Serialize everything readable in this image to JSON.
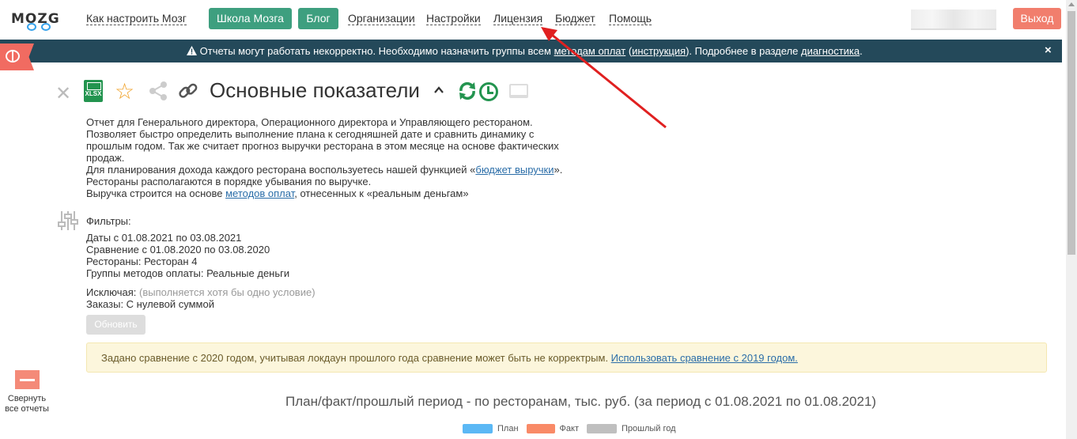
{
  "nav": {
    "logo": "MOZG",
    "links": [
      "Как настроить Мозг",
      "Организации",
      "Настройки",
      "Лицензия",
      "Бюджет",
      "Помощь"
    ],
    "school_button": "Школа Мозга",
    "blog_button": "Блог",
    "logout_button": "Выход"
  },
  "banner": {
    "warning_icon": "warning-icon",
    "text_1": "Отчеты могут работать некорректно. Необходимо назначить группы всем ",
    "link_1": "методам оплат",
    "text_2": " (",
    "link_2": "инструкция",
    "text_3": "). Подробнее в разделе ",
    "link_3": "диагностика",
    "text_4": ".",
    "close": "×"
  },
  "toolbar": {
    "xlsx_label": "XLSX",
    "title": "Основные показатели"
  },
  "description": {
    "line_1": "Отчет для Генерального директора, Операционного директора и Управляющего рестораном.",
    "line_2": "Позволяет быстро определить выполнение плана к сегодняшней дате и сравнить динамику с прошлым годом. Так же считает прогноз выручки ресторана в этом месяце на основе фактических продаж.",
    "line_3_pre": "Для планирования дохода каждого ресторана воспользуетесь нашей функцией «",
    "line_3_link": "бюджет выручки",
    "line_3_post": "».",
    "line_4": "Рестораны располагаются в порядке убывания по выручке.",
    "line_5_pre": "Выручка строится на основе ",
    "line_5_link": "методов оплат",
    "line_5_post": ", отнесенных к «реальным деньгам»"
  },
  "filters": {
    "heading": "Фильтры:",
    "dates_label": "Даты",
    "dates_value": " с 01.08.2021 по 03.08.2021",
    "compare_label": "Сравнение",
    "compare_value": " с 01.08.2020 по 03.08.2020",
    "restaurants_label": "Рестораны:",
    "restaurants_value": " Ресторан 4",
    "groups_label": "Группы методов оплаты:",
    "groups_value": " Реальные деньги",
    "exclude_label": "Исключая:",
    "exclude_note": " (выполняется хотя бы одно условие)",
    "orders_label": "Заказы:",
    "orders_value": " С нулевой суммой",
    "update_button": "Обновить"
  },
  "alert": {
    "text": "Задано сравнение с 2020 годом, учитывая локдаун прошлого года сравнение может быть не корректрым. ",
    "link": "Использовать сравнение с 2019 годом."
  },
  "sidebar": {
    "collapse_label": "Свернуть все отчеты"
  },
  "chart": {
    "title": "План/факт/прошлый период - по ресторанам, тыс. руб. (за период с 01.08.2021 по 01.08.2021)",
    "legend": [
      {
        "label": "План",
        "color": "#5bb8f5"
      },
      {
        "label": "Факт",
        "color": "#f98a67"
      },
      {
        "label": "Прошлый год",
        "color": "#bfbfbf"
      }
    ]
  },
  "colors": {
    "banner_bg": "#24495a",
    "nav_button_green": "#3e9f7f",
    "logout_red": "#f17e6d",
    "annotation_arrow": "#e02020"
  }
}
